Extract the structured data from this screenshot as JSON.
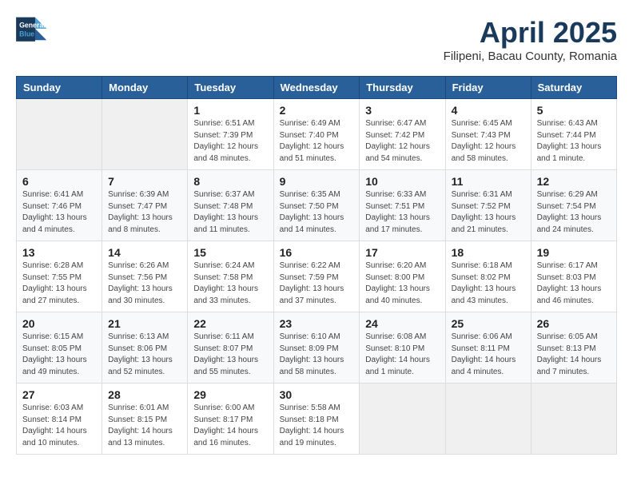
{
  "header": {
    "logo_line1": "General",
    "logo_line2": "Blue",
    "title": "April 2025",
    "subtitle": "Filipeni, Bacau County, Romania"
  },
  "weekdays": [
    "Sunday",
    "Monday",
    "Tuesday",
    "Wednesday",
    "Thursday",
    "Friday",
    "Saturday"
  ],
  "weeks": [
    [
      {
        "day": "",
        "info": ""
      },
      {
        "day": "",
        "info": ""
      },
      {
        "day": "1",
        "info": "Sunrise: 6:51 AM\nSunset: 7:39 PM\nDaylight: 12 hours\nand 48 minutes."
      },
      {
        "day": "2",
        "info": "Sunrise: 6:49 AM\nSunset: 7:40 PM\nDaylight: 12 hours\nand 51 minutes."
      },
      {
        "day": "3",
        "info": "Sunrise: 6:47 AM\nSunset: 7:42 PM\nDaylight: 12 hours\nand 54 minutes."
      },
      {
        "day": "4",
        "info": "Sunrise: 6:45 AM\nSunset: 7:43 PM\nDaylight: 12 hours\nand 58 minutes."
      },
      {
        "day": "5",
        "info": "Sunrise: 6:43 AM\nSunset: 7:44 PM\nDaylight: 13 hours\nand 1 minute."
      }
    ],
    [
      {
        "day": "6",
        "info": "Sunrise: 6:41 AM\nSunset: 7:46 PM\nDaylight: 13 hours\nand 4 minutes."
      },
      {
        "day": "7",
        "info": "Sunrise: 6:39 AM\nSunset: 7:47 PM\nDaylight: 13 hours\nand 8 minutes."
      },
      {
        "day": "8",
        "info": "Sunrise: 6:37 AM\nSunset: 7:48 PM\nDaylight: 13 hours\nand 11 minutes."
      },
      {
        "day": "9",
        "info": "Sunrise: 6:35 AM\nSunset: 7:50 PM\nDaylight: 13 hours\nand 14 minutes."
      },
      {
        "day": "10",
        "info": "Sunrise: 6:33 AM\nSunset: 7:51 PM\nDaylight: 13 hours\nand 17 minutes."
      },
      {
        "day": "11",
        "info": "Sunrise: 6:31 AM\nSunset: 7:52 PM\nDaylight: 13 hours\nand 21 minutes."
      },
      {
        "day": "12",
        "info": "Sunrise: 6:29 AM\nSunset: 7:54 PM\nDaylight: 13 hours\nand 24 minutes."
      }
    ],
    [
      {
        "day": "13",
        "info": "Sunrise: 6:28 AM\nSunset: 7:55 PM\nDaylight: 13 hours\nand 27 minutes."
      },
      {
        "day": "14",
        "info": "Sunrise: 6:26 AM\nSunset: 7:56 PM\nDaylight: 13 hours\nand 30 minutes."
      },
      {
        "day": "15",
        "info": "Sunrise: 6:24 AM\nSunset: 7:58 PM\nDaylight: 13 hours\nand 33 minutes."
      },
      {
        "day": "16",
        "info": "Sunrise: 6:22 AM\nSunset: 7:59 PM\nDaylight: 13 hours\nand 37 minutes."
      },
      {
        "day": "17",
        "info": "Sunrise: 6:20 AM\nSunset: 8:00 PM\nDaylight: 13 hours\nand 40 minutes."
      },
      {
        "day": "18",
        "info": "Sunrise: 6:18 AM\nSunset: 8:02 PM\nDaylight: 13 hours\nand 43 minutes."
      },
      {
        "day": "19",
        "info": "Sunrise: 6:17 AM\nSunset: 8:03 PM\nDaylight: 13 hours\nand 46 minutes."
      }
    ],
    [
      {
        "day": "20",
        "info": "Sunrise: 6:15 AM\nSunset: 8:05 PM\nDaylight: 13 hours\nand 49 minutes."
      },
      {
        "day": "21",
        "info": "Sunrise: 6:13 AM\nSunset: 8:06 PM\nDaylight: 13 hours\nand 52 minutes."
      },
      {
        "day": "22",
        "info": "Sunrise: 6:11 AM\nSunset: 8:07 PM\nDaylight: 13 hours\nand 55 minutes."
      },
      {
        "day": "23",
        "info": "Sunrise: 6:10 AM\nSunset: 8:09 PM\nDaylight: 13 hours\nand 58 minutes."
      },
      {
        "day": "24",
        "info": "Sunrise: 6:08 AM\nSunset: 8:10 PM\nDaylight: 14 hours\nand 1 minute."
      },
      {
        "day": "25",
        "info": "Sunrise: 6:06 AM\nSunset: 8:11 PM\nDaylight: 14 hours\nand 4 minutes."
      },
      {
        "day": "26",
        "info": "Sunrise: 6:05 AM\nSunset: 8:13 PM\nDaylight: 14 hours\nand 7 minutes."
      }
    ],
    [
      {
        "day": "27",
        "info": "Sunrise: 6:03 AM\nSunset: 8:14 PM\nDaylight: 14 hours\nand 10 minutes."
      },
      {
        "day": "28",
        "info": "Sunrise: 6:01 AM\nSunset: 8:15 PM\nDaylight: 14 hours\nand 13 minutes."
      },
      {
        "day": "29",
        "info": "Sunrise: 6:00 AM\nSunset: 8:17 PM\nDaylight: 14 hours\nand 16 minutes."
      },
      {
        "day": "30",
        "info": "Sunrise: 5:58 AM\nSunset: 8:18 PM\nDaylight: 14 hours\nand 19 minutes."
      },
      {
        "day": "",
        "info": ""
      },
      {
        "day": "",
        "info": ""
      },
      {
        "day": "",
        "info": ""
      }
    ]
  ]
}
